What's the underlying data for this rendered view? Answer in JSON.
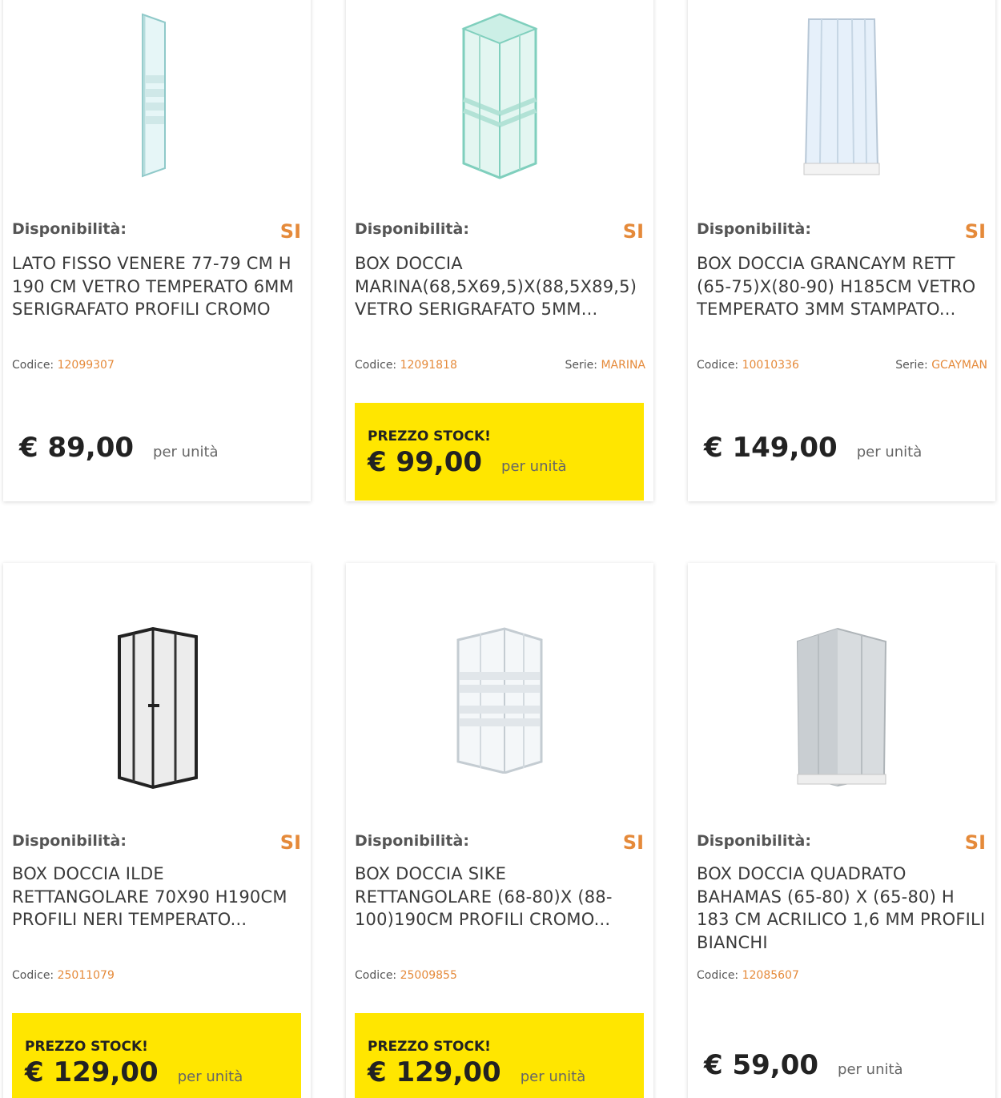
{
  "labels": {
    "availability": "Disponibilità:",
    "code": "Codice: ",
    "serie": "Serie: ",
    "stock": "PREZZO STOCK!",
    "per_unit": "per unità"
  },
  "products": [
    {
      "availability": "SI",
      "title": "LATO FISSO VENERE 77-79 CM H 190 CM VETRO TEMPERATO 6MM SERIGRAFATO PROFILI CROMO",
      "code": "12099307",
      "price": "€ 89,00",
      "image_icon": "shower-side-panel-icon"
    },
    {
      "availability": "SI",
      "title": "BOX DOCCIA MARINA(68,5X69,5)X(88,5X89,5) VETRO SERIGRAFATO 5MM...",
      "code": "12091818",
      "serie": "MARINA",
      "stock_label": "PREZZO STOCK!",
      "price": "€ 99,00",
      "image_icon": "shower-box-green-glass-icon"
    },
    {
      "availability": "SI",
      "title": "BOX DOCCIA GRANCAYM RETT (65-75)X(80-90) H185CM VETRO TEMPERATO 3MM STAMPATO...",
      "code": "10010336",
      "serie": "GCAYMAN",
      "price": "€ 149,00",
      "image_icon": "shower-box-white-icon"
    },
    {
      "availability": "SI",
      "title": "BOX DOCCIA ILDE RETTANGOLARE 70X90 H190CM PROFILI NERI TEMPERATO...",
      "code": "25011079",
      "stock_label": "PREZZO STOCK!",
      "price": "€ 129,00",
      "image_icon": "shower-box-black-frame-icon"
    },
    {
      "availability": "SI",
      "title": "BOX DOCCIA SIKE RETTANGOLARE (68-80)X (88-100)190CM PROFILI CROMO...",
      "code": "25009855",
      "stock_label": "PREZZO STOCK!",
      "price": "€ 129,00",
      "image_icon": "shower-box-chrome-icon"
    },
    {
      "availability": "SI",
      "title": "BOX DOCCIA QUADRATO BAHAMAS (65-80) X (65-80) H 183 CM ACRILICO 1,6 MM PROFILI BIANCHI",
      "code": "12085607",
      "price": "€ 59,00",
      "image_icon": "shower-box-acrylic-icon"
    }
  ],
  "colors": {
    "accent_orange": "#e58a3a",
    "stock_yellow": "#ffe600"
  }
}
